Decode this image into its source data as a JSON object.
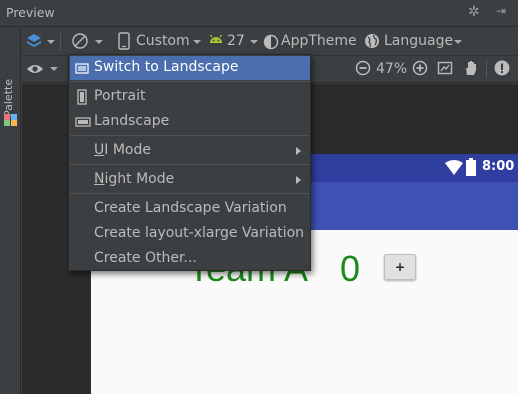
{
  "titlebar": {
    "title": "Preview"
  },
  "palette": {
    "label": "Palette"
  },
  "toolbar": {
    "device_label": "Custom",
    "api_label": "27",
    "theme_label": "AppTheme",
    "language_label": "Language",
    "zoom_label": "47%"
  },
  "menu": {
    "switch": "Switch to Landscape",
    "portrait": "Portrait",
    "landscape": "Landscape",
    "ui_mode_u": "U",
    "ui_mode_rest": "I Mode",
    "night_mode_n": "N",
    "night_mode_rest": "ight Mode",
    "create_landscape": "Create Landscape Variation",
    "create_xlarge": "Create layout-xlarge Variation",
    "create_other": "Create Other..."
  },
  "device": {
    "time": "8:00",
    "team": "Team A",
    "score": "0",
    "plus": "+"
  },
  "colors": {
    "selection": "#4b6eaf",
    "primary_dark": "#303f9f",
    "primary": "#3f51b5",
    "text_green": "#1a8a1a"
  },
  "icons": [
    "gear-icon",
    "hide-icon",
    "layers-icon",
    "orientation-icon",
    "phone-icon",
    "android-icon",
    "theme-icon",
    "globe-icon",
    "eye-icon",
    "zoom-out-icon",
    "zoom-in-icon",
    "fit-screen-icon",
    "pan-icon",
    "warning-icon"
  ]
}
